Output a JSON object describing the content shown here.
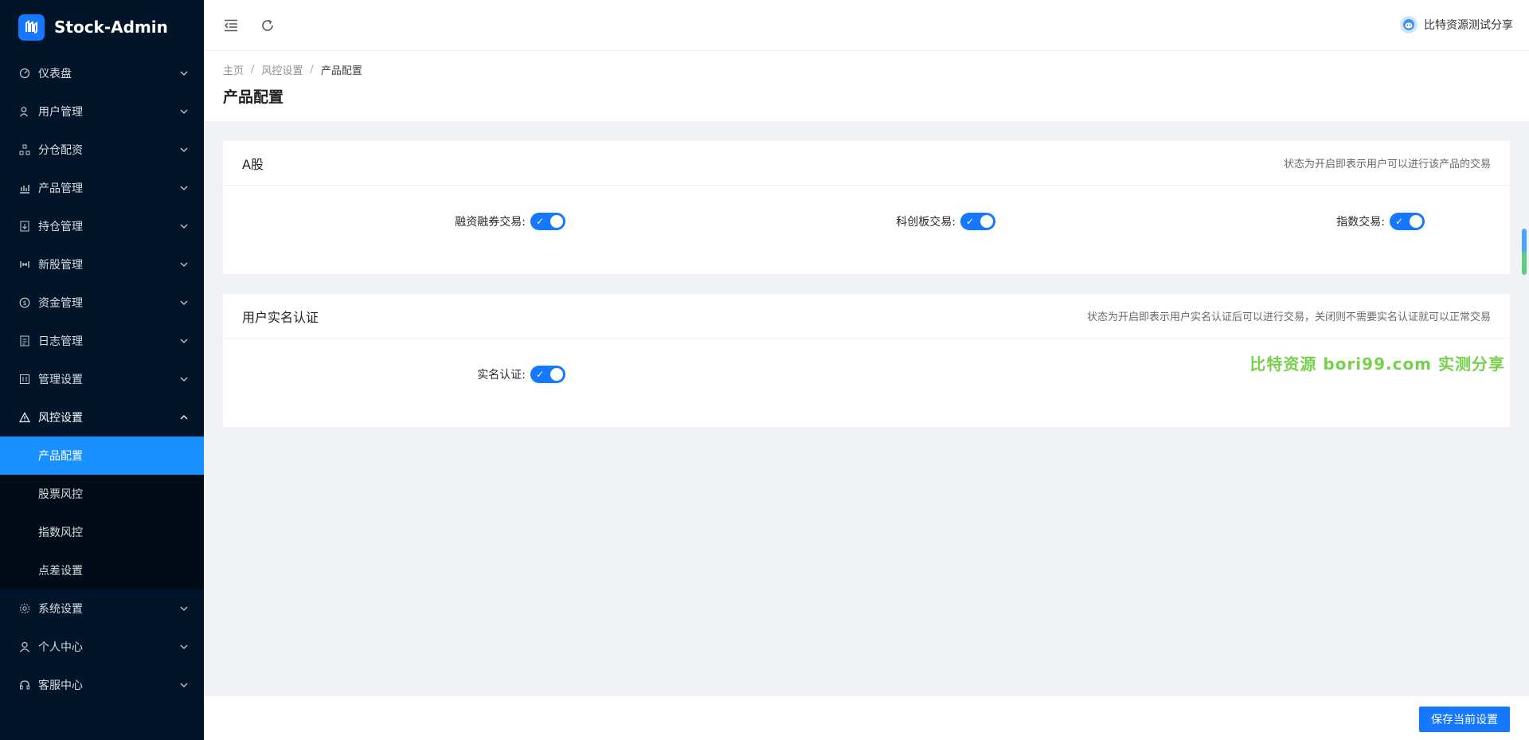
{
  "app": {
    "title": "Stock-Admin"
  },
  "sidebar": {
    "items": [
      {
        "label": "仪表盘",
        "icon": "dashboard-icon"
      },
      {
        "label": "用户管理",
        "icon": "user-manage-icon"
      },
      {
        "label": "分仓配资",
        "icon": "cluster-icon"
      },
      {
        "label": "产品管理",
        "icon": "chart-icon"
      },
      {
        "label": "持仓管理",
        "icon": "position-icon"
      },
      {
        "label": "新股管理",
        "icon": "new-stock-icon"
      },
      {
        "label": "资金管理",
        "icon": "money-icon"
      },
      {
        "label": "日志管理",
        "icon": "log-icon"
      },
      {
        "label": "管理设置",
        "icon": "manage-settings-icon"
      },
      {
        "label": "风控设置",
        "icon": "warning-icon",
        "open": true
      },
      {
        "label": "系统设置",
        "icon": "gear-icon"
      },
      {
        "label": "个人中心",
        "icon": "person-icon"
      },
      {
        "label": "客服中心",
        "icon": "headset-icon"
      }
    ],
    "submenu": [
      {
        "label": "产品配置",
        "active": true
      },
      {
        "label": "股票风控"
      },
      {
        "label": "指数风控"
      },
      {
        "label": "点差设置"
      }
    ]
  },
  "header": {
    "user_name": "比特资源测试分享"
  },
  "breadcrumb": {
    "home": "主页",
    "parent": "风控设置",
    "current": "产品配置",
    "sep": "/"
  },
  "page": {
    "title": "产品配置"
  },
  "cards": {
    "a_share": {
      "title": "A股",
      "extra": "状态为开启即表示用户可以进行该产品的交易",
      "fields": [
        {
          "label": "融资融券交易:",
          "on": true
        },
        {
          "label": "科创板交易:",
          "on": true
        },
        {
          "label": "指数交易:",
          "on": true
        }
      ]
    },
    "realname": {
      "title": "用户实名认证",
      "extra": "状态为开启即表示用户实名认证后可以进行交易，关闭则不需要实名认证就可以正常交易",
      "fields": [
        {
          "label": "实名认证:",
          "on": true
        }
      ],
      "watermark": "比特资源 bori99.com 实测分享"
    }
  },
  "footer": {
    "save_label": "保存当前设置"
  },
  "colors": {
    "primary": "#1677ff",
    "sidebar_bg": "#001529",
    "submenu_bg": "#000c17",
    "watermark": "#52c41a"
  }
}
